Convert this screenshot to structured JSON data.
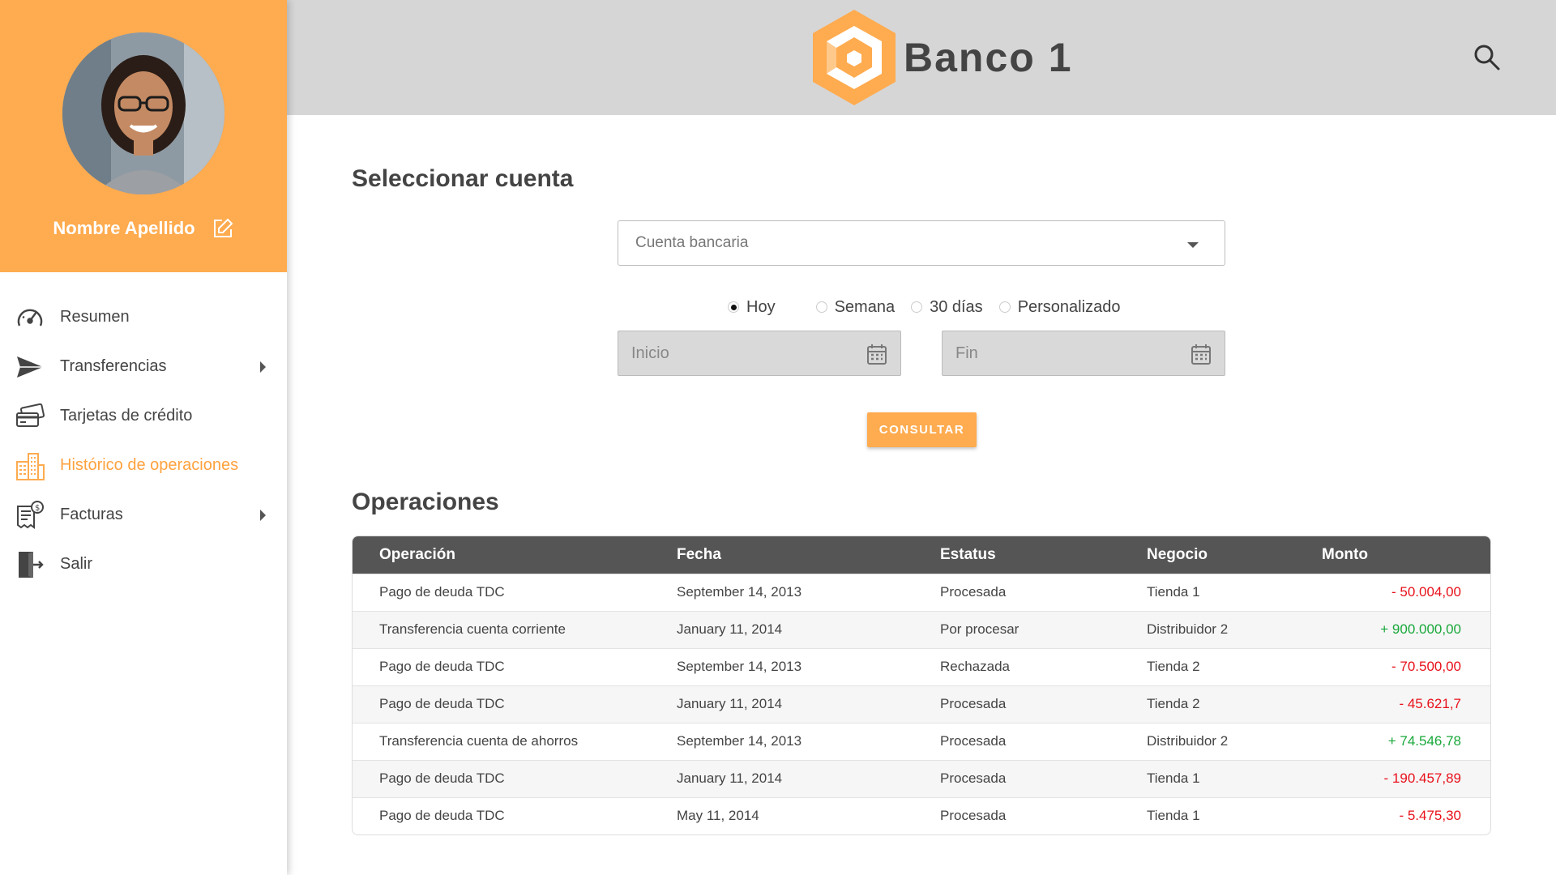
{
  "profile": {
    "name": "Nombre Apellido"
  },
  "nav": {
    "items": [
      {
        "label": "Resumen",
        "icon": "speedometer-icon",
        "has_arrow": false,
        "active": false
      },
      {
        "label": "Transferencias",
        "icon": "paper-plane-icon",
        "has_arrow": true,
        "active": false
      },
      {
        "label": "Tarjetas de crédito",
        "icon": "credit-cards-icon",
        "has_arrow": false,
        "active": false
      },
      {
        "label": "Histórico de operaciones",
        "icon": "buildings-icon",
        "has_arrow": false,
        "active": true
      },
      {
        "label": "Facturas",
        "icon": "invoice-icon",
        "has_arrow": true,
        "active": false
      },
      {
        "label": "Salir",
        "icon": "exit-door-icon",
        "has_arrow": false,
        "active": false
      }
    ]
  },
  "header": {
    "logo_text": "Banco 1"
  },
  "main": {
    "select_title": "Seleccionar cuenta",
    "account_placeholder": "Cuenta bancaria",
    "radios": [
      {
        "label": "Hoy",
        "checked": true
      },
      {
        "label": "Semana",
        "checked": false
      },
      {
        "label": "30 días",
        "checked": false
      },
      {
        "label": "Personalizado",
        "checked": false
      }
    ],
    "start_placeholder": "Inicio",
    "end_placeholder": "Fin",
    "consult_button": "CONSULTAR",
    "operations_title": "Operaciones"
  },
  "table": {
    "headers": [
      "Operación",
      "Fecha",
      "Estatus",
      "Negocio",
      "Monto"
    ],
    "rows": [
      [
        "Pago de deuda TDC",
        "September 14, 2013",
        "Procesada",
        "Tienda 1",
        "- 50.004,00"
      ],
      [
        "Transferencia cuenta corriente",
        "January 11, 2014",
        "Por procesar",
        "Distribuidor 2",
        "+ 900.000,00"
      ],
      [
        "Pago de deuda TDC",
        "September 14, 2013",
        "Rechazada",
        "Tienda 2",
        "- 70.500,00"
      ],
      [
        "Pago de deuda TDC",
        "January 11, 2014",
        "Procesada",
        "Tienda 2",
        "- 45.621,7"
      ],
      [
        "Transferencia cuenta de ahorros",
        "September 14, 2013",
        "Procesada",
        "Distribuidor 2",
        "+ 74.546,78"
      ],
      [
        "Pago de deuda TDC",
        "January 11, 2014",
        "Procesada",
        "Tienda 1",
        "- 190.457,89"
      ],
      [
        "Pago de deuda TDC",
        "May 11, 2014",
        "Procesada",
        "Tienda 1",
        "- 5.475,30"
      ]
    ]
  },
  "colors": {
    "accent": "#ffab4f",
    "header_bg": "#d6d6d6",
    "table_header": "#555555",
    "negative": "#e8111b",
    "positive": "#19a83a"
  }
}
